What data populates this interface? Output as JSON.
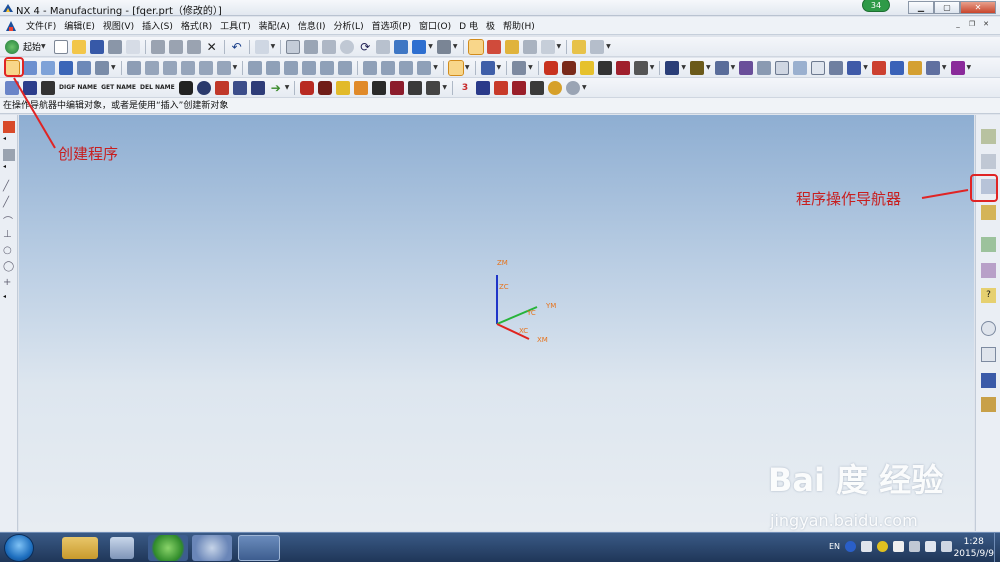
{
  "window": {
    "title": "NX 4 - Manufacturing - [fqer.prt（修改的）]",
    "badge": "34",
    "min_icon": "minimize-icon",
    "max_icon": "maximize-icon",
    "close_icon": "close-icon"
  },
  "menu": {
    "items": [
      "文件(F)",
      "编辑(E)",
      "视图(V)",
      "插入(S)",
      "格式(R)",
      "工具(T)",
      "装配(A)",
      "信息(I)",
      "分析(L)",
      "首选项(P)",
      "窗口(O)",
      "D 电",
      "极",
      "帮助(H)"
    ]
  },
  "toolbar": {
    "start_label": "起始",
    "small_labels": [
      "DIGF NAME",
      "GET NAME",
      "DEL NAME"
    ]
  },
  "status": {
    "message": "在操作导航器中编辑对象，或者是使用“插入”创建新对象"
  },
  "triad": {
    "labels": [
      "ZM",
      "ZC",
      "YM",
      "YC",
      "XC",
      "XM"
    ],
    "colors": {
      "x": "#e0241f",
      "y": "#27b43a",
      "z": "#1f35c8",
      "label": "#e6731c"
    }
  },
  "annotations": {
    "create_program": "创建程序",
    "program_navigator": "程序操作导航器",
    "color": "#c81e1e"
  },
  "watermark": {
    "logo": "Bai 度 经验",
    "url": "jingyan.baidu.com"
  },
  "taskbar": {
    "lang": "EN",
    "time": "1:28",
    "date": "2015/9/9"
  }
}
